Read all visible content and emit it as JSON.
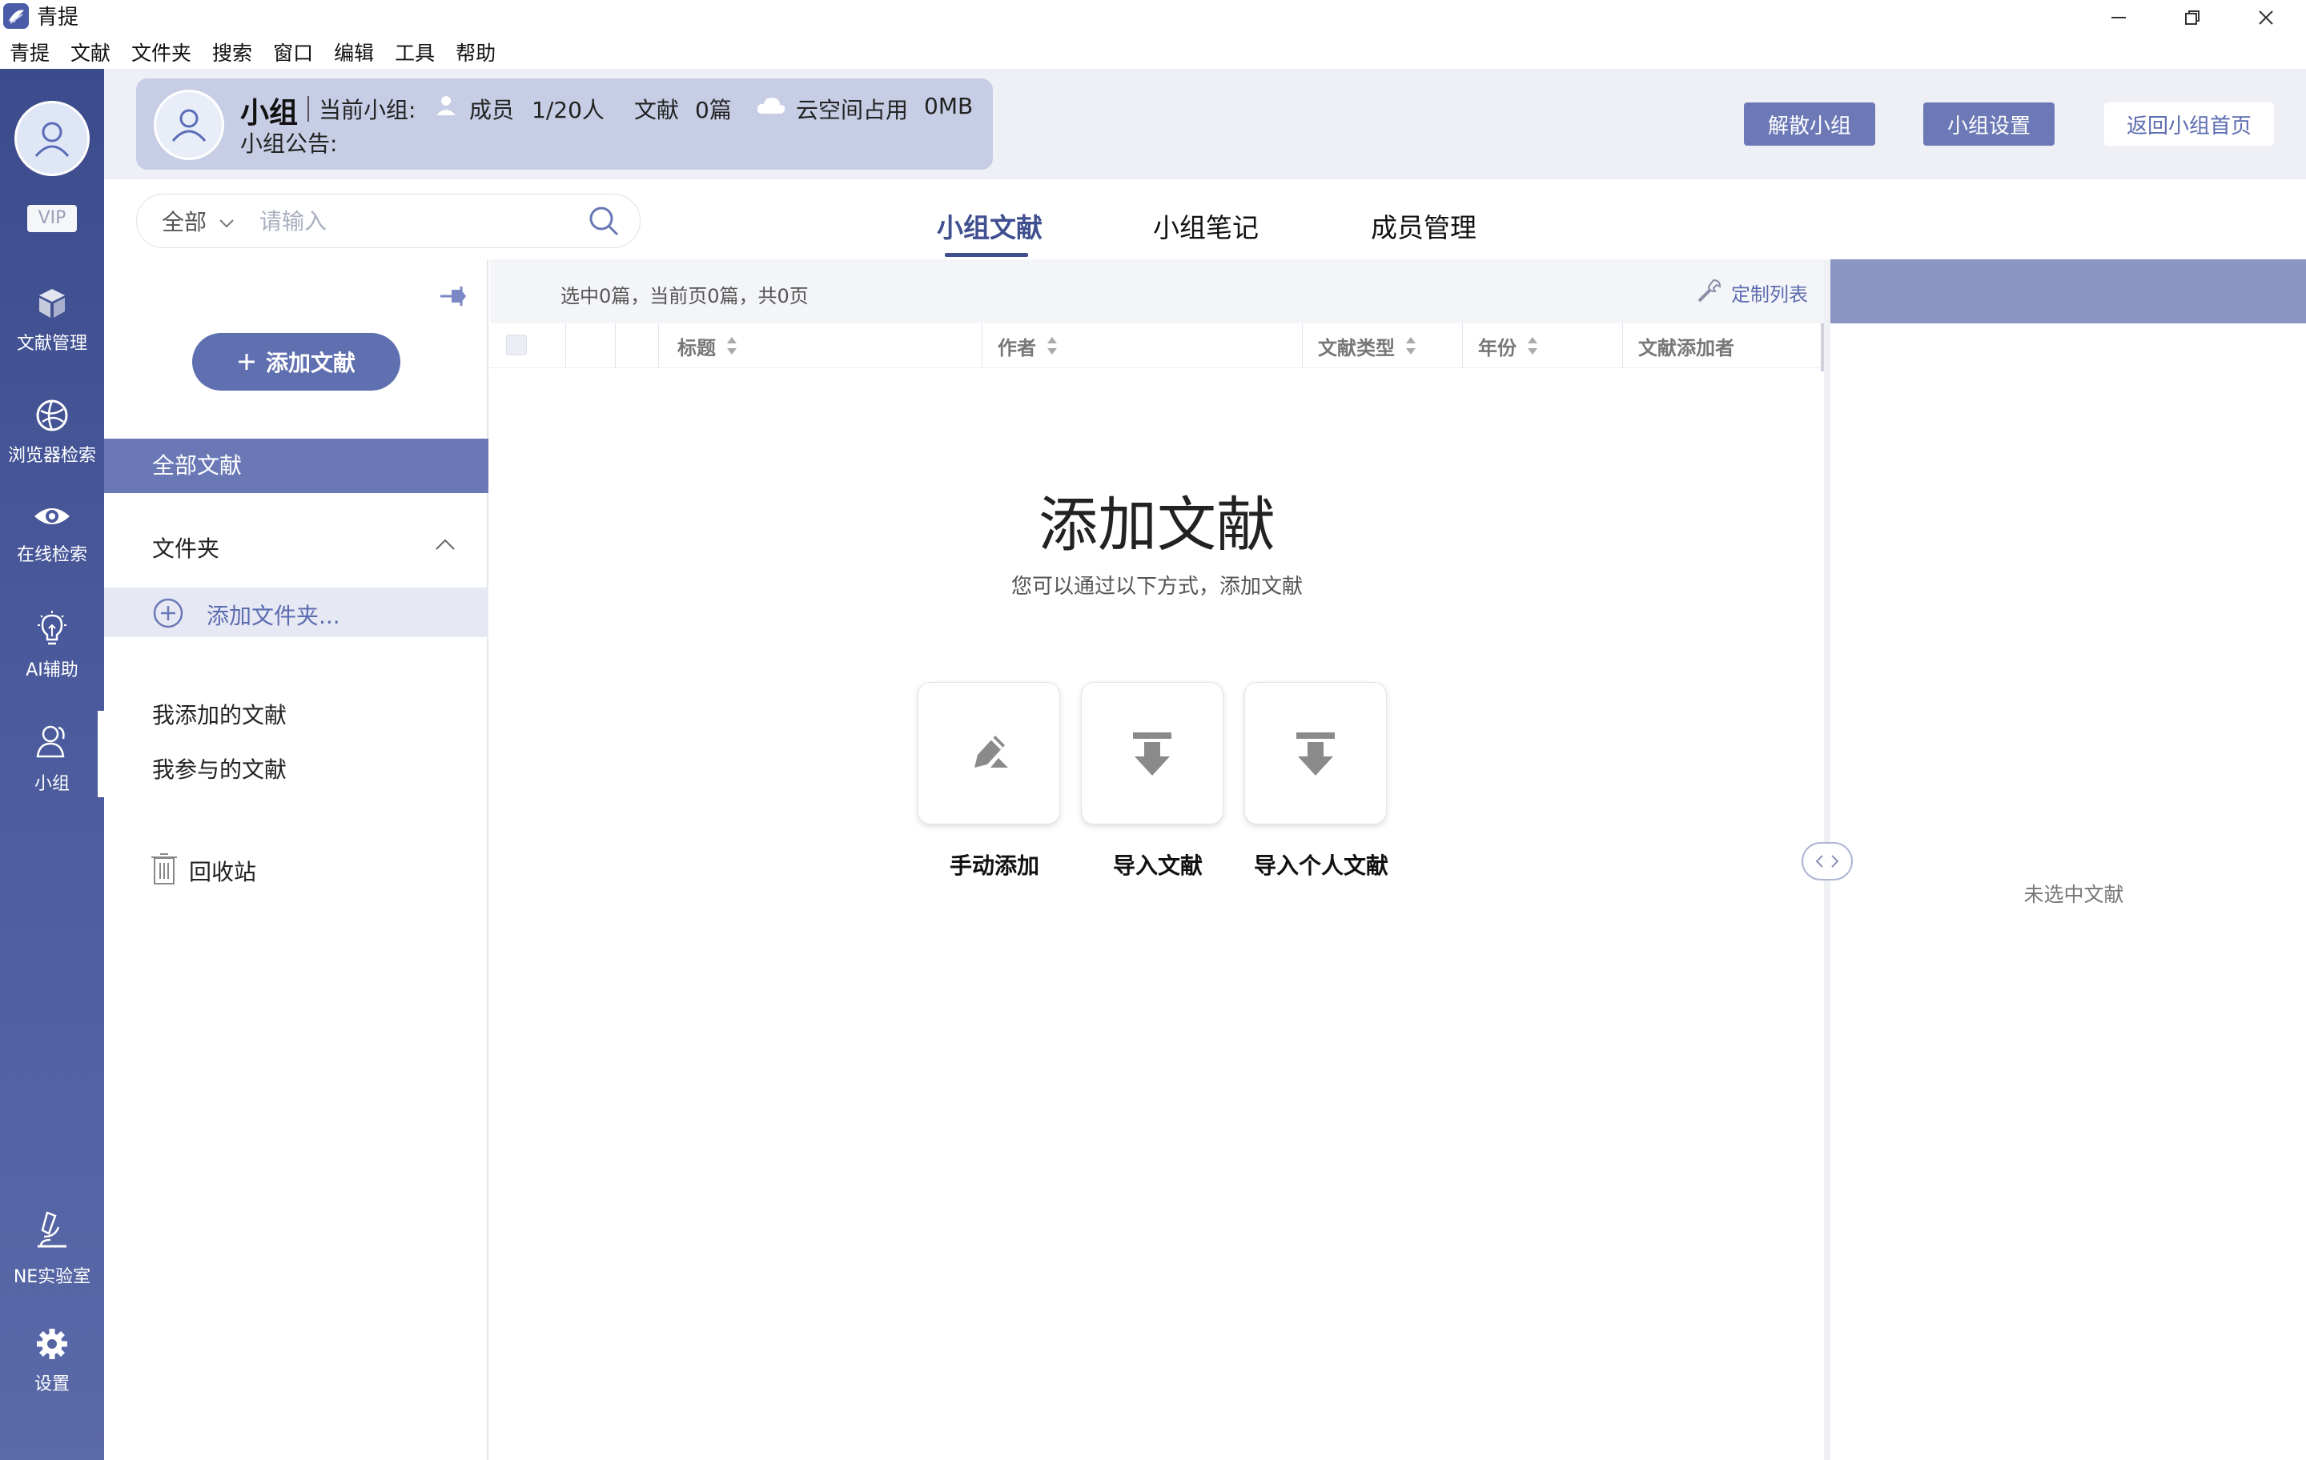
{
  "window": {
    "title": "青提",
    "controls": {
      "minimize": "minimize-icon",
      "restore": "restore-icon",
      "close": "close-icon"
    }
  },
  "menu": [
    "青提",
    "文献",
    "文件夹",
    "搜索",
    "窗口",
    "编辑",
    "工具",
    "帮助"
  ],
  "nav": {
    "vip": "VIP",
    "items": [
      {
        "label": "文献管理",
        "icon": "cube-icon"
      },
      {
        "label": "浏览器检索",
        "icon": "globe-icon"
      },
      {
        "label": "在线检索",
        "icon": "eye-icon"
      },
      {
        "label": "AI辅助",
        "icon": "lightbulb-icon"
      },
      {
        "label": "小组",
        "icon": "group-icon"
      },
      {
        "label": "NE实验室",
        "icon": "microscope-icon"
      },
      {
        "label": "设置",
        "icon": "gear-icon"
      }
    ],
    "active": "小组"
  },
  "group": {
    "name": "小组",
    "current_label": "当前小组:",
    "members_label": "成员",
    "members_value": "1/20人",
    "docs_label": "文献",
    "docs_value": "0篇",
    "cloud_label": "云空间占用",
    "cloud_value": "0MB",
    "notice_label": "小组公告:"
  },
  "header_buttons": {
    "dissolve": "解散小组",
    "settings": "小组设置",
    "back": "返回小组首页"
  },
  "search": {
    "scope": "全部",
    "placeholder": "请输入"
  },
  "tabs": [
    "小组文献",
    "小组笔记",
    "成员管理"
  ],
  "active_tab": "小组文献",
  "sidebar": {
    "add_button": "添加文献",
    "all_docs": "全部文献",
    "folder_section": "文件夹",
    "add_folder": "添加文件夹...",
    "my_added": "我添加的文献",
    "my_participated": "我参与的文献",
    "trash": "回收站"
  },
  "list": {
    "status": "选中0篇，当前页0篇，共0页",
    "customize": "定制列表",
    "columns": [
      "标题",
      "作者",
      "文献类型",
      "年份",
      "文献添加者"
    ]
  },
  "empty": {
    "title": "添加文献",
    "subtitle": "您可以通过以下方式，添加文献",
    "actions": [
      {
        "label": "手动添加",
        "icon": "pen-icon"
      },
      {
        "label": "导入文献",
        "icon": "import-arrow-icon"
      },
      {
        "label": "导入个人文献",
        "icon": "import-arrow-icon"
      }
    ]
  },
  "right_panel": {
    "empty_text": "未选中文献"
  },
  "colors": {
    "nav_bg": "#3c4b8b",
    "accent": "#5f6fb0",
    "group_card": "#c7cde4",
    "selected_row": "#6a78b6"
  }
}
